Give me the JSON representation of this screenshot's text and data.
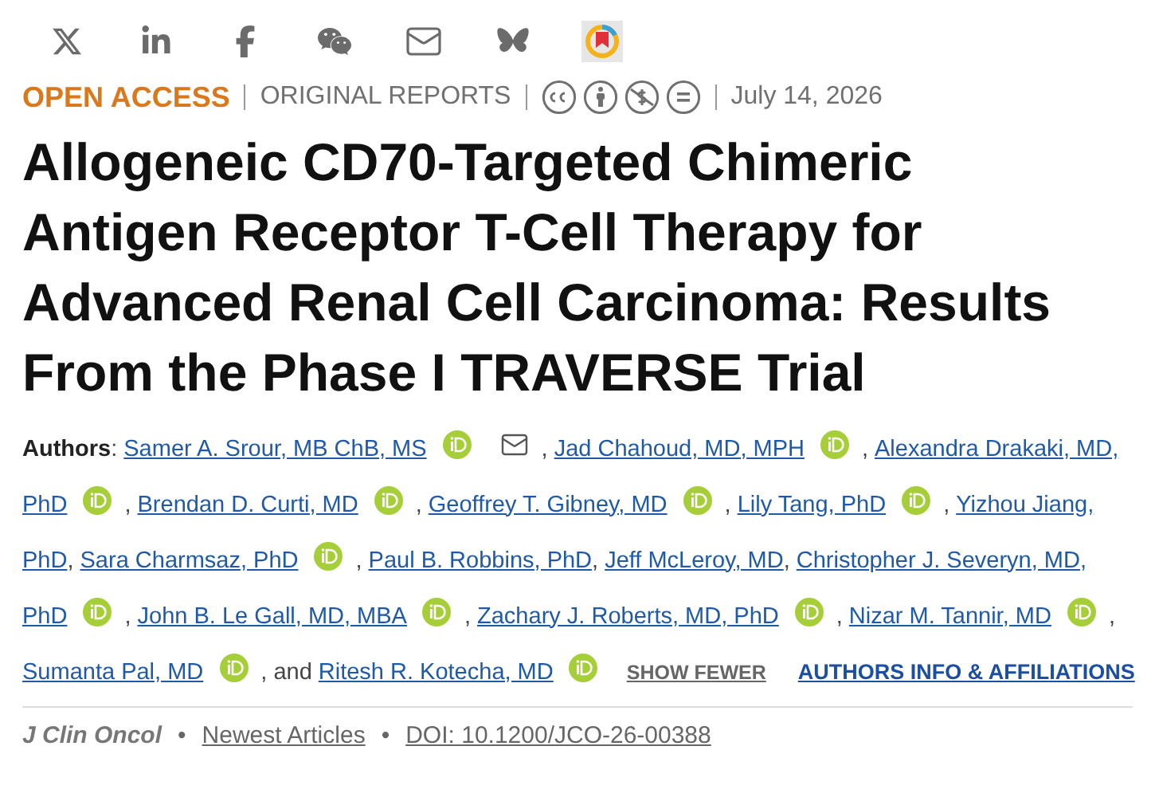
{
  "share_icons": [
    {
      "kind": "x"
    },
    {
      "kind": "linkedin"
    },
    {
      "kind": "facebook"
    },
    {
      "kind": "wechat"
    },
    {
      "kind": "email"
    },
    {
      "kind": "butterfly"
    },
    {
      "kind": "app"
    }
  ],
  "meta": {
    "access": "OPEN ACCESS",
    "type": "ORIGINAL REPORTS",
    "licenses": [
      {
        "kind": "cc"
      },
      {
        "kind": "by"
      },
      {
        "kind": "nc"
      },
      {
        "kind": "nd"
      }
    ],
    "date": "July 14, 2026"
  },
  "title": "Allogeneic CD70-Targeted Chimeric Antigen Receptor T-Cell Therapy for Advanced Renal Cell Carcinoma: Results From the Phase I TRAVERSE Trial",
  "authors_label": "Authors",
  "authors_colon": ":",
  "author_lines": [
    {
      "authors": [
        {
          "name": "Samer A. Srour, MB ChB, MS",
          "orcid": true,
          "email": true
        },
        {
          "prefix": ",",
          "name": "Jad Chahoud, MD, MPH",
          "orcid": true
        },
        {
          "prefix": ",",
          "name": "Alexandra Drakaki, MD,",
          "orcid": false
        }
      ]
    },
    {
      "authors": [
        {
          "name": "PhD",
          "orcid": true
        },
        {
          "prefix": ",",
          "name": "Brendan D. Curti, MD",
          "orcid": true
        },
        {
          "prefix": ",",
          "name": "Geoffrey T. Gibney, MD",
          "orcid": true
        },
        {
          "prefix": ",",
          "name": "Lily Tang, PhD",
          "orcid": true
        },
        {
          "prefix": ",",
          "name": "Yizhou Jiang,",
          "orcid": false
        }
      ]
    },
    {
      "authors": [
        {
          "name": "PhD",
          "orcid": false
        },
        {
          "prefix": ",",
          "name": "Sara Charmsaz, PhD",
          "orcid": true
        },
        {
          "prefix": ",",
          "name": "Paul B. Robbins, PhD",
          "orcid": false
        },
        {
          "prefix": ",",
          "name": "Jeff McLeroy, MD",
          "orcid": false
        },
        {
          "prefix": ",",
          "name": "Christopher J. Severyn, MD,",
          "orcid": false
        }
      ]
    },
    {
      "authors": [
        {
          "name": "PhD",
          "orcid": true
        },
        {
          "prefix": ",",
          "name": "John B. Le Gall, MD, MBA",
          "orcid": true
        },
        {
          "prefix": ",",
          "name": "Zachary J. Roberts, MD, PhD",
          "orcid": true
        },
        {
          "prefix": ",",
          "name": "Nizar M. Tannir, MD",
          "orcid": true
        }
      ],
      "trailing": ","
    },
    {
      "authors": [
        {
          "name": "Sumanta Pal, MD",
          "orcid": true
        },
        {
          "prefix": ", and",
          "name": "Ritesh R. Kotecha, MD",
          "orcid": true
        }
      ]
    }
  ],
  "show_fewer": "SHOW FEWER",
  "affiliations": "AUTHORS INFO & AFFILIATIONS",
  "journal": "J Clin Oncol",
  "bullet": "•",
  "section_link": "Newest Articles",
  "bullet_2": "•",
  "doi": "DOI: 10.1200/JCO-26-00388"
}
